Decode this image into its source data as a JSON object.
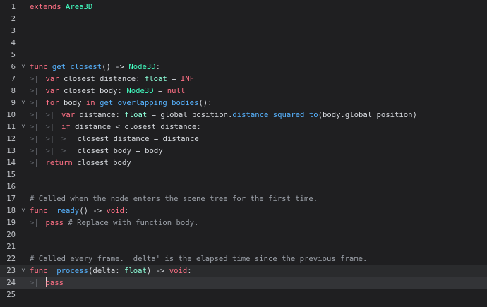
{
  "editor": {
    "lines": [
      {
        "n": "1",
        "fold": "",
        "tabs": 0,
        "tokens": [
          {
            "t": "extends",
            "c": "kw"
          },
          {
            "t": " ",
            "c": "pn"
          },
          {
            "t": "Area3D",
            "c": "cl"
          }
        ]
      },
      {
        "n": "2",
        "fold": "",
        "tabs": 0,
        "tokens": []
      },
      {
        "n": "3",
        "fold": "",
        "tabs": 0,
        "tokens": []
      },
      {
        "n": "4",
        "fold": "",
        "tabs": 0,
        "tokens": []
      },
      {
        "n": "5",
        "fold": "",
        "tabs": 0,
        "tokens": []
      },
      {
        "n": "6",
        "fold": "v",
        "tabs": 0,
        "tokens": [
          {
            "t": "func",
            "c": "kw"
          },
          {
            "t": " ",
            "c": "pn"
          },
          {
            "t": "get_closest",
            "c": "fn"
          },
          {
            "t": "() -> ",
            "c": "pn"
          },
          {
            "t": "Node3D",
            "c": "cl"
          },
          {
            "t": ":",
            "c": "pn"
          }
        ]
      },
      {
        "n": "7",
        "fold": "",
        "tabs": 1,
        "tokens": [
          {
            "t": "var",
            "c": "kw"
          },
          {
            "t": " closest_distance: ",
            "c": "pn"
          },
          {
            "t": "float",
            "c": "ty"
          },
          {
            "t": " = ",
            "c": "pn"
          },
          {
            "t": "INF",
            "c": "num"
          }
        ]
      },
      {
        "n": "8",
        "fold": "",
        "tabs": 1,
        "tokens": [
          {
            "t": "var",
            "c": "kw"
          },
          {
            "t": " closest_body: ",
            "c": "pn"
          },
          {
            "t": "Node3D",
            "c": "cl"
          },
          {
            "t": " = ",
            "c": "pn"
          },
          {
            "t": "null",
            "c": "kw"
          }
        ]
      },
      {
        "n": "9",
        "fold": "v",
        "tabs": 1,
        "tokens": [
          {
            "t": "for",
            "c": "kw"
          },
          {
            "t": " body ",
            "c": "pn"
          },
          {
            "t": "in",
            "c": "kw"
          },
          {
            "t": " ",
            "c": "pn"
          },
          {
            "t": "get_overlapping_bodies",
            "c": "fn"
          },
          {
            "t": "():",
            "c": "pn"
          }
        ]
      },
      {
        "n": "10",
        "fold": "",
        "tabs": 2,
        "tokens": [
          {
            "t": "var",
            "c": "kw"
          },
          {
            "t": " distance: ",
            "c": "pn"
          },
          {
            "t": "float",
            "c": "ty"
          },
          {
            "t": " = global_position.",
            "c": "pn"
          },
          {
            "t": "distance_squared_to",
            "c": "fn"
          },
          {
            "t": "(body.global_position)",
            "c": "pn"
          }
        ]
      },
      {
        "n": "11",
        "fold": "v",
        "tabs": 2,
        "tokens": [
          {
            "t": "if",
            "c": "kw"
          },
          {
            "t": " distance < closest_distance:",
            "c": "pn"
          }
        ]
      },
      {
        "n": "12",
        "fold": "",
        "tabs": 3,
        "tokens": [
          {
            "t": "closest_distance = distance",
            "c": "pn"
          }
        ]
      },
      {
        "n": "13",
        "fold": "",
        "tabs": 3,
        "tokens": [
          {
            "t": "closest_body = body",
            "c": "pn"
          }
        ]
      },
      {
        "n": "14",
        "fold": "",
        "tabs": 1,
        "tokens": [
          {
            "t": "return",
            "c": "kw"
          },
          {
            "t": " closest_body",
            "c": "pn"
          }
        ]
      },
      {
        "n": "15",
        "fold": "",
        "tabs": 0,
        "tokens": []
      },
      {
        "n": "16",
        "fold": "",
        "tabs": 0,
        "tokens": []
      },
      {
        "n": "17",
        "fold": "",
        "tabs": 0,
        "tokens": [
          {
            "t": "# Called when the node enters the scene tree for the first time.",
            "c": "cm"
          }
        ]
      },
      {
        "n": "18",
        "fold": "v",
        "tabs": 0,
        "tokens": [
          {
            "t": "func",
            "c": "kw"
          },
          {
            "t": " ",
            "c": "pn"
          },
          {
            "t": "_ready",
            "c": "fn"
          },
          {
            "t": "() -> ",
            "c": "pn"
          },
          {
            "t": "void",
            "c": "kw"
          },
          {
            "t": ":",
            "c": "pn"
          }
        ]
      },
      {
        "n": "19",
        "fold": "",
        "tabs": 1,
        "tokens": [
          {
            "t": "pass",
            "c": "kw"
          },
          {
            "t": " ",
            "c": "pn"
          },
          {
            "t": "# Replace with function body.",
            "c": "cm"
          }
        ]
      },
      {
        "n": "20",
        "fold": "",
        "tabs": 0,
        "tokens": []
      },
      {
        "n": "21",
        "fold": "",
        "tabs": 0,
        "tokens": []
      },
      {
        "n": "22",
        "fold": "",
        "tabs": 0,
        "tokens": [
          {
            "t": "# Called every frame. 'delta' is the elapsed time since the previous frame.",
            "c": "cm"
          }
        ]
      },
      {
        "n": "23",
        "fold": "v",
        "tabs": 0,
        "hl": "prev",
        "tokens": [
          {
            "t": "func",
            "c": "kw"
          },
          {
            "t": " ",
            "c": "pn"
          },
          {
            "t": "_process",
            "c": "fn"
          },
          {
            "t": "(delta: ",
            "c": "pn"
          },
          {
            "t": "float",
            "c": "ty"
          },
          {
            "t": ") -> ",
            "c": "pn"
          },
          {
            "t": "void",
            "c": "kw"
          },
          {
            "t": ":",
            "c": "pn"
          }
        ]
      },
      {
        "n": "24",
        "fold": "",
        "tabs": 1,
        "hl": "cur",
        "caret": true,
        "tokens": [
          {
            "t": "pass",
            "c": "kw"
          }
        ]
      },
      {
        "n": "25",
        "fold": "",
        "tabs": 0,
        "tokens": []
      }
    ],
    "tab_glyph": ">|",
    "fold_glyph": "⌄"
  }
}
